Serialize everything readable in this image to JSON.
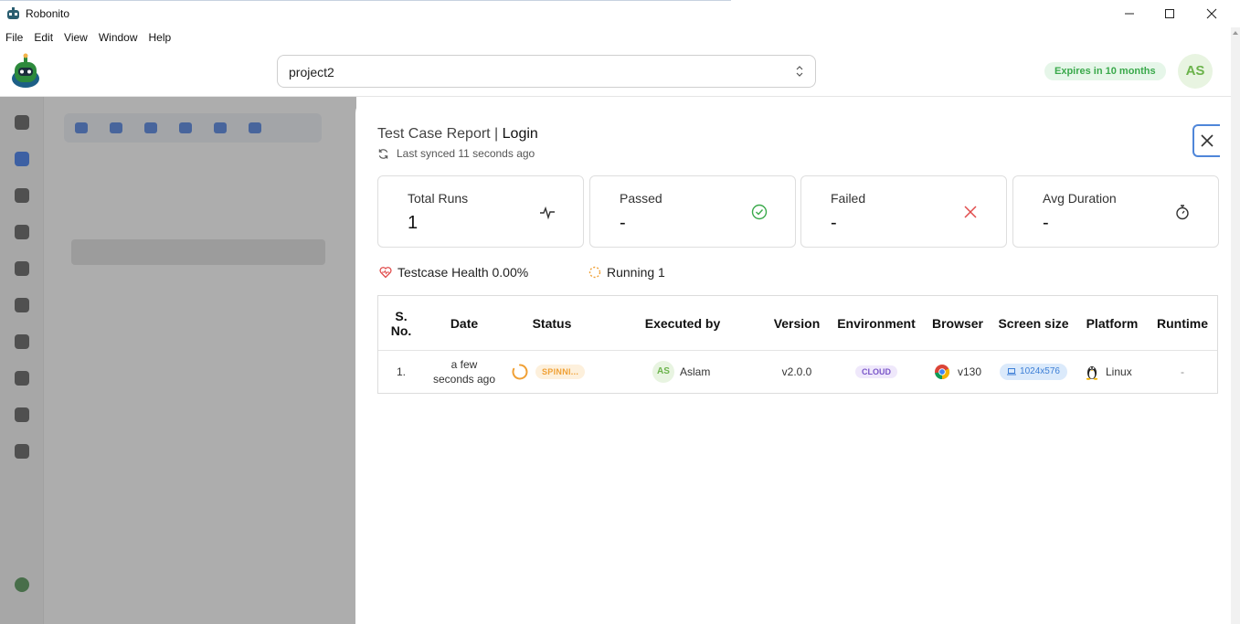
{
  "window": {
    "title": "Robonito",
    "minimize": "minimize",
    "maximize": "maximize",
    "close": "close"
  },
  "menu": [
    "File",
    "Edit",
    "View",
    "Window",
    "Help"
  ],
  "header": {
    "project": "project2",
    "expires": "Expires in 10 months",
    "avatar": "AS"
  },
  "report": {
    "title_prefix": "Test Case Report | ",
    "title_name": "Login",
    "synced": "Last synced 11 seconds ago",
    "cards": [
      {
        "label": "Total Runs",
        "value": "1",
        "icon": "activity-icon"
      },
      {
        "label": "Passed",
        "value": "-",
        "icon": "check-circle-icon",
        "color": "#3aa94b"
      },
      {
        "label": "Failed",
        "value": "-",
        "icon": "x-icon",
        "color": "#e04a4a"
      },
      {
        "label": "Avg Duration",
        "value": "-",
        "icon": "stopwatch-icon"
      }
    ],
    "health": "Testcase Health 0.00%",
    "running": "Running 1",
    "columns": [
      "S. No.",
      "Date",
      "Status",
      "Executed by",
      "Version",
      "Environment",
      "Browser",
      "Screen size",
      "Platform",
      "Runtime"
    ],
    "rows": [
      {
        "sno": "1.",
        "date": "a few seconds ago",
        "status": "SPINNI...",
        "executed_avatar": "AS",
        "executed_by": "Aslam",
        "version": "v2.0.0",
        "environment": "CLOUD",
        "browser": "v130",
        "screen": "1024x576",
        "platform": "Linux",
        "runtime": "-"
      }
    ]
  },
  "colors": {
    "accent": "#4f86d9",
    "green": "#3aa94b",
    "orange": "#f0a035",
    "red": "#e04a4a"
  }
}
